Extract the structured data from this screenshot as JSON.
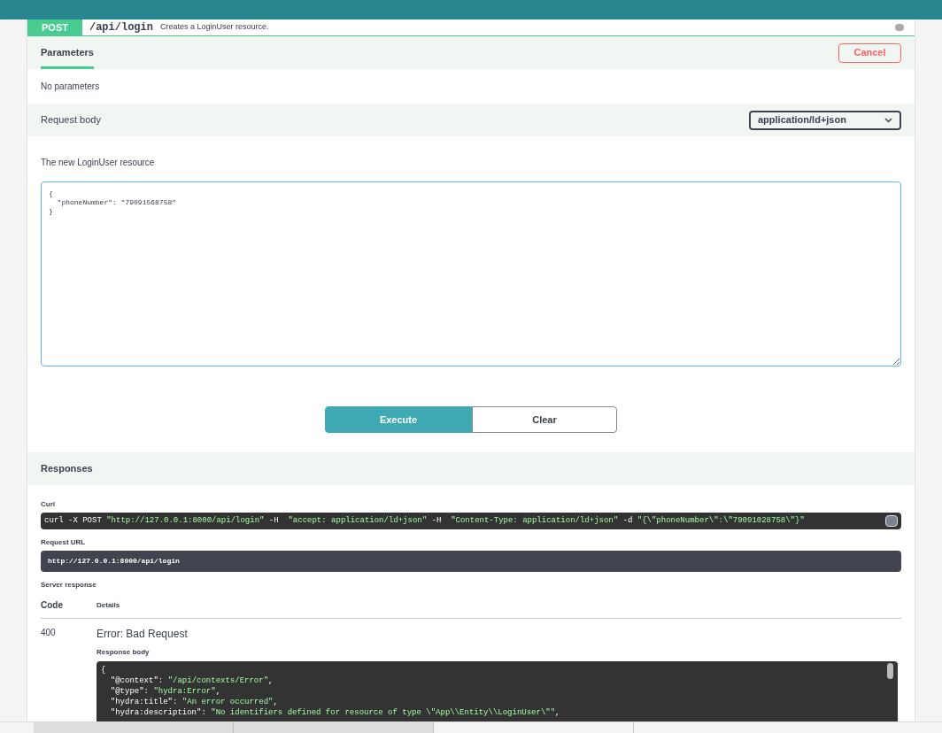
{
  "operation": {
    "method": "POST",
    "path": "/api/login",
    "summary": "Creates a LoginUser resource."
  },
  "parameters": {
    "tab": {
      "label": "Parameters",
      "selected": true
    },
    "cancel": "Cancel",
    "empty": "No parameters"
  },
  "request_body": {
    "label": "Request body",
    "content_type": "application/ld+json",
    "description": "The new LoginUser resource",
    "value": "{\n  \"phoneNumber\": \"79091568758\"\n}"
  },
  "actions": [
    {
      "label": "Execute",
      "kind": "primary"
    },
    {
      "label": "Clear",
      "kind": "secondary"
    }
  ],
  "responses": {
    "title": "Responses",
    "curl_label": "Curl",
    "curl": [
      {
        "kind": "plain",
        "text": "curl -X POST "
      },
      {
        "kind": "string",
        "text": "\"http://127.0.0.1:8000/api/login\""
      },
      {
        "kind": "plain",
        "text": " -H  "
      },
      {
        "kind": "string",
        "text": "\"accept: application/ld+json\""
      },
      {
        "kind": "plain",
        "text": " -H  "
      },
      {
        "kind": "string",
        "text": "\"Content-Type: application/ld+json\""
      },
      {
        "kind": "plain",
        "text": " -d "
      },
      {
        "kind": "string",
        "text": "\"{\\\"phoneNumber\\\":\\\"79091028758\\\"}\""
      }
    ],
    "request_url_label": "Request URL",
    "request_url": "http://127.0.0.1:8000/api/login",
    "server_response_label": "Server response",
    "columns": [
      "Code",
      "Details"
    ],
    "code": "400",
    "status": "Error: Bad Request",
    "body_label": "Response body",
    "body": [
      {
        "key": "{"
      },
      {
        "key": "  \"@context\": ",
        "value": "\"/api/contexts/Error\"",
        "tail": ","
      },
      {
        "key": "  \"@type\": ",
        "value": "\"hydra:Error\"",
        "tail": ","
      },
      {
        "key": "  \"hydra:title\": ",
        "value": "\"An error occurred\"",
        "tail": ","
      },
      {
        "key": "  \"hydra:description\": ",
        "value": "\"No identifiers defined for resource of type \\\"App\\\\Entity\\\\LoginUser\\\"\"",
        "tail": ","
      }
    ]
  }
}
